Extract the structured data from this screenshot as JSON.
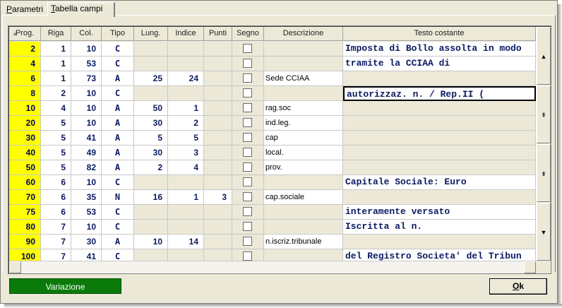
{
  "tabs": [
    {
      "label": "Parametri",
      "hotkey": "P",
      "rest": "arametri",
      "active": false
    },
    {
      "label": "Tabella campi",
      "hotkey": "T",
      "rest": "abella campi",
      "active": true
    }
  ],
  "grid": {
    "columns": [
      "Prog.",
      "Riga",
      "Col.",
      "Tipo",
      "Lung.",
      "Indice",
      "Punti",
      "Segno",
      "Descrizione",
      "Testo costante"
    ],
    "rows": [
      {
        "prog": "2",
        "riga": "1",
        "col": "10",
        "tipo": "C",
        "lung": "",
        "indice": "",
        "punti": "",
        "descrizione": "",
        "testo": "Imposta di Bollo assolta in modo"
      },
      {
        "prog": "4",
        "riga": "1",
        "col": "53",
        "tipo": "C",
        "lung": "",
        "indice": "",
        "punti": "",
        "descrizione": "",
        "testo": "tramite la CCIAA di"
      },
      {
        "prog": "6",
        "riga": "1",
        "col": "73",
        "tipo": "A",
        "lung": "25",
        "indice": "24",
        "punti": "",
        "descrizione": "Sede CCIAA",
        "testo": ""
      },
      {
        "prog": "8",
        "riga": "2",
        "col": "10",
        "tipo": "C",
        "lung": "",
        "indice": "",
        "punti": "",
        "descrizione": "",
        "testo": "autorizzaz. n.     /     Rep.II ("
      },
      {
        "prog": "10",
        "riga": "4",
        "col": "10",
        "tipo": "A",
        "lung": "50",
        "indice": "1",
        "punti": "",
        "descrizione": "rag.soc",
        "testo": ""
      },
      {
        "prog": "20",
        "riga": "5",
        "col": "10",
        "tipo": "A",
        "lung": "30",
        "indice": "2",
        "punti": "",
        "descrizione": "ind.leg.",
        "testo": ""
      },
      {
        "prog": "30",
        "riga": "5",
        "col": "41",
        "tipo": "A",
        "lung": "5",
        "indice": "5",
        "punti": "",
        "descrizione": "cap",
        "testo": ""
      },
      {
        "prog": "40",
        "riga": "5",
        "col": "49",
        "tipo": "A",
        "lung": "30",
        "indice": "3",
        "punti": "",
        "descrizione": "local.",
        "testo": ""
      },
      {
        "prog": "50",
        "riga": "5",
        "col": "82",
        "tipo": "A",
        "lung": "2",
        "indice": "4",
        "punti": "",
        "descrizione": "prov.",
        "testo": ""
      },
      {
        "prog": "60",
        "riga": "6",
        "col": "10",
        "tipo": "C",
        "lung": "",
        "indice": "",
        "punti": "",
        "descrizione": "",
        "testo": "Capitale Sociale: Euro"
      },
      {
        "prog": "70",
        "riga": "6",
        "col": "35",
        "tipo": "N",
        "lung": "16",
        "indice": "1",
        "punti": "3",
        "descrizione": "cap.sociale",
        "testo": ""
      },
      {
        "prog": "75",
        "riga": "6",
        "col": "53",
        "tipo": "C",
        "lung": "",
        "indice": "",
        "punti": "",
        "descrizione": "",
        "testo": "interamente versato"
      },
      {
        "prog": "80",
        "riga": "7",
        "col": "10",
        "tipo": "C",
        "lung": "",
        "indice": "",
        "punti": "",
        "descrizione": "",
        "testo": "Iscritta al n."
      },
      {
        "prog": "90",
        "riga": "7",
        "col": "30",
        "tipo": "A",
        "lung": "10",
        "indice": "14",
        "punti": "",
        "descrizione": "n.iscriz.tribunale",
        "testo": ""
      },
      {
        "prog": "100",
        "riga": "7",
        "col": "41",
        "tipo": "C",
        "lung": "",
        "indice": "",
        "punti": "",
        "descrizione": "",
        "testo": "del Registro Societa' del Tribun"
      }
    ]
  },
  "buttons": {
    "variazione": "Variazione",
    "ok_hotkey": "O",
    "ok_rest": "k"
  },
  "icons": {
    "sort": "sort-ascending-icon",
    "scroll_up": "arrow-up-icon",
    "page_up": "double-arrow-up-icon",
    "page_down": "double-arrow-down-icon",
    "scroll_down": "arrow-down-icon"
  },
  "colors": {
    "prog_background": "#ffff00",
    "variazione_background": "#0a7a0a",
    "text_navy": "#0b1a60"
  }
}
